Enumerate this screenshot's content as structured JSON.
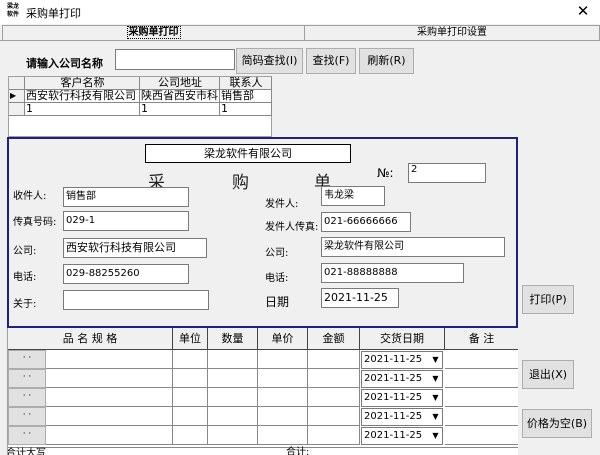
{
  "window": {
    "title": "采购单打印",
    "icon_text": "梁龙\n软件",
    "close": "✕"
  },
  "tabs": [
    {
      "label": "采购单打印"
    },
    {
      "label": "采购单打印设置"
    }
  ],
  "search": {
    "label": "请输入公司名称",
    "value": "",
    "btn_pinyin": "简码查找(I)",
    "btn_search": "查找(F)",
    "btn_refresh": "刷新(R)"
  },
  "grid": {
    "headers": [
      "客户名称",
      "公司地址",
      "联系人"
    ],
    "rows": [
      {
        "marker": "▶",
        "cells": [
          "西安软行科技有限公司",
          "陕西省西安市科",
          "销售部"
        ]
      },
      {
        "marker": "",
        "cells": [
          "1",
          "1",
          "1"
        ]
      }
    ]
  },
  "form": {
    "company": "梁龙软件有限公司",
    "title_chars": [
      "采",
      "购",
      "单"
    ],
    "no_label": "№:",
    "no_value": "2",
    "receiver_label": "收件人:",
    "receiver": "销售部",
    "fax_label": "传真号码:",
    "fax": "029-1",
    "company_label": "公司:",
    "receiver_company": "西安软行科技有限公司",
    "phone_label": "电话:",
    "phone": "029-88255260",
    "about_label": "关于:",
    "about": "",
    "sender_label": "发件人:",
    "sender": "韦龙梁",
    "sender_fax_label": "发件人传真:",
    "sender_fax": "021-66666666",
    "sender_company_label": "公司:",
    "sender_company": "梁龙软件有限公司",
    "sender_phone_label": "电话:",
    "sender_phone": "021-88888888",
    "date_label": "日期",
    "date": "2021-11-25"
  },
  "buttons": {
    "print": "打印(P)",
    "exit": "退出(X)",
    "zero": "价格为空(B)"
  },
  "detail": {
    "headers": [
      "品 名 规 格",
      "单位",
      "数量",
      "单价",
      "金额",
      "交货日期",
      "备  注"
    ],
    "row_button": "· ·",
    "rows": [
      {
        "date": "2021-11-25"
      },
      {
        "date": "2021-11-25"
      },
      {
        "date": "2021-11-25"
      },
      {
        "date": "2021-11-25"
      },
      {
        "date": "2021-11-25"
      }
    ],
    "footer_left": "合计大写",
    "footer_total": "合计:"
  }
}
